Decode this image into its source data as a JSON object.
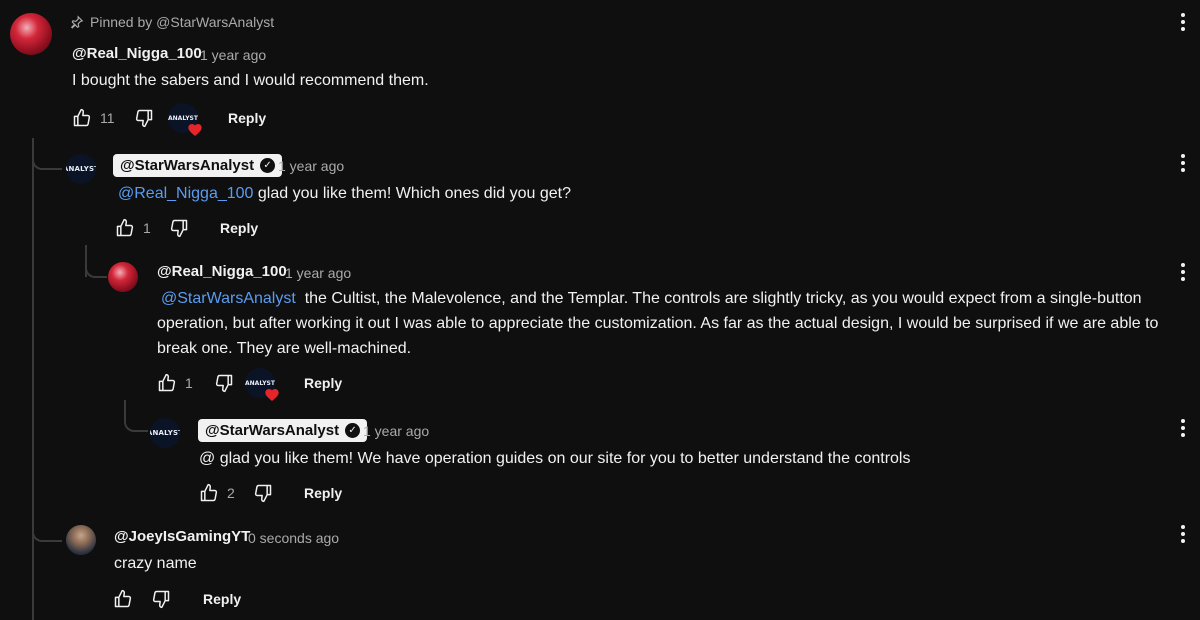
{
  "pinned_label": "Pinned by @StarWarsAnalyst",
  "comments": [
    {
      "author": "@Real_Nigga_100",
      "time": "1 year ago",
      "text": "I bought the sabers and I would recommend them.",
      "likes": "11",
      "reply": "Reply"
    },
    {
      "author": "@StarWarsAnalyst",
      "time": "1 year ago",
      "mention": "@Real_Nigga_100",
      "text": " glad you like them! Which ones did you get?",
      "likes": "1",
      "reply": "Reply"
    },
    {
      "author": "@Real_Nigga_100",
      "time": "1 year ago",
      "mention": "@StarWarsAnalyst",
      "text": "  the Cultist, the Malevolence, and the Templar. The controls are slightly tricky, as you would expect from a single-button operation, but after working it out I was able to appreciate the customization. As far as the actual design, I would be surprised if we are able to break one. They are well-machined.",
      "likes": "1",
      "reply": "Reply"
    },
    {
      "author": "@StarWarsAnalyst",
      "time": "1 year ago",
      "text": "@ glad you like them! We have operation guides on our site for you to better understand the controls",
      "likes": "2",
      "reply": "Reply"
    },
    {
      "author": "@JoeyIsGamingYT",
      "time": "0 seconds ago",
      "text": "crazy name",
      "reply": "Reply"
    }
  ],
  "avatar_text": "ANALYST",
  "colors": {
    "background": "#0f0f0f",
    "mention": "#5b9cf2",
    "heart": "#e5252a",
    "muted": "#aaaaaa"
  },
  "icons": [
    "pin-icon",
    "thumbs-up-icon",
    "thumbs-down-icon",
    "heart-icon",
    "more-vert-icon",
    "verified-icon"
  ]
}
